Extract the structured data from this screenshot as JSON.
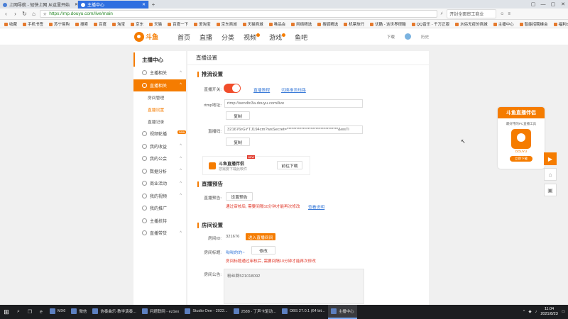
{
  "browser": {
    "tabs": [
      {
        "label": "上网导航 - 轻快上网 从这里开始",
        "active": false
      },
      {
        "label": "主播中心",
        "active": true
      }
    ],
    "tab_add": "+",
    "window_controls": [
      "▢",
      "—",
      "▢",
      "✕"
    ],
    "url": "https://mp.douyu.com/live/main",
    "search_text": "开封全面审工商业",
    "bookmarks": [
      "收藏",
      "手机书签",
      "苏宁易购",
      "搜索",
      "百度",
      "淘宝",
      "京东",
      "天猫",
      "百度一下",
      "爱淘宝",
      "京东商城",
      "天猫商城",
      "唯品会",
      "网络精选",
      "搜狐精选",
      "机票旅行",
      "优酷 - 这世界很酷",
      "QQ音乐 - 千万正版",
      "水俗无疫的商城",
      "主播中心",
      "智能招聘峰会",
      "福利boss招聘"
    ]
  },
  "header": {
    "logo_text": "斗鱼",
    "nav": [
      "首页",
      "直播",
      "分类",
      "视频",
      "游戏",
      "鱼吧"
    ],
    "right_items": [
      "下载",
      "历史"
    ]
  },
  "sidebar": {
    "title": "主播中心",
    "items": [
      {
        "label": "主播相关",
        "chevron": "^",
        "active": false
      },
      {
        "label": "直播相关",
        "chevron": "^",
        "active": true
      },
      {
        "label": "视频轮播",
        "chevron": "",
        "active": false,
        "badge": "new"
      },
      {
        "label": "我的收益",
        "chevron": "^",
        "active": false
      },
      {
        "label": "我的公会",
        "chevron": "^",
        "active": false
      },
      {
        "label": "数据分析",
        "chevron": "^",
        "active": false
      },
      {
        "label": "商业活动",
        "chevron": "^",
        "active": false
      },
      {
        "label": "我的视频",
        "chevron": "^",
        "active": false
      },
      {
        "label": "我的推广",
        "chevron": "",
        "active": false
      },
      {
        "label": "主播扶持",
        "chevron": "",
        "active": false
      },
      {
        "label": "直播带货",
        "chevron": "^",
        "active": false
      }
    ],
    "subitems": [
      {
        "label": "房间管理",
        "active": false
      },
      {
        "label": "直播设置",
        "active": true
      },
      {
        "label": "直播记录",
        "active": false
      }
    ]
  },
  "main": {
    "page_title": "直播设置",
    "stream": {
      "section_title": "推流设置",
      "switch_label": "直播开关:",
      "switch_on": true,
      "link_tutorial": "直播教程",
      "link_line": "切换推流线路",
      "rtmp_label": "rtmp地址:",
      "rtmp_value": "rtmp://sendtc3a.douyu.com/live",
      "copy_label": "复制",
      "code_label": "直播码:",
      "code_value": "321676rGYTJ194cm?wsSecret=********************************&wsTi",
      "copy_label2": "复制",
      "promo_name": "斗鱼直播伴侣",
      "promo_new": "NEW",
      "promo_desc": "您需要下载此软件",
      "promo_download": "前往下载"
    },
    "notice": {
      "section_title": "直播预告",
      "label": "直播预告:",
      "button": "设置预告",
      "hint": "通过审核后, 需要间隔10分钟才能再次修改",
      "link": "查看说明"
    },
    "room": {
      "section_title": "房间设置",
      "id_label": "房间ID:",
      "id_value": "321676",
      "enter_button": "进入直播间间",
      "title_label": "房间标题:",
      "title_value": "呦呦的的~",
      "edit_button": "修改",
      "title_hint": "房间标题通过审核后, 需要间隔10分钟才能再次修改",
      "announce_label": "房间公告:",
      "announce_value": "粉丝群521018092"
    }
  },
  "ad": {
    "title": "斗鱼直播伴侣",
    "subtitle": "最好用的PC直播工具",
    "logo_text": "DOUYU",
    "button": "立即下载"
  },
  "side_tools": [
    "▶",
    "⌂",
    "▣"
  ],
  "taskbar": {
    "apps": [
      {
        "label": "MX6",
        "active": false
      },
      {
        "label": "微信",
        "active": false
      },
      {
        "label": "协奏曲乐·教学演奏...",
        "active": false
      },
      {
        "label": "问题联网 - ez1ex",
        "active": false
      },
      {
        "label": "Studio One - 2022...",
        "active": false
      },
      {
        "label": "2588 - 丁声卡驱动...",
        "active": false
      },
      {
        "label": "OBS 27.0.1 (64 bit...",
        "active": false
      },
      {
        "label": "主播中心",
        "active": true
      }
    ],
    "time": "11:04",
    "date": "2021/8/23"
  }
}
